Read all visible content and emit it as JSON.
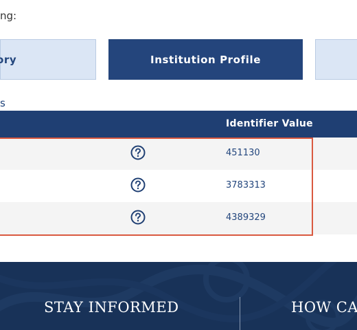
{
  "intro": {
    "text": "ng:"
  },
  "tabs": [
    {
      "label": "ory"
    },
    {
      "label": "Institution Profile"
    },
    {
      "label": ""
    }
  ],
  "section": {
    "label": "s"
  },
  "table": {
    "header": "Identifier Value",
    "rows": [
      {
        "value": "451130",
        "icon": "question-circle-icon"
      },
      {
        "value": "3783313",
        "icon": "question-circle-icon"
      },
      {
        "value": "4389329",
        "icon": "question-circle-icon"
      }
    ]
  },
  "footer": {
    "left": "STAY INFORMED",
    "right": "HOW CAN"
  },
  "colors": {
    "primary": "#24457c",
    "header": "#1f3f73",
    "light_tab": "#dbe6f5",
    "highlight": "#d9583f",
    "footer": "#183258"
  }
}
